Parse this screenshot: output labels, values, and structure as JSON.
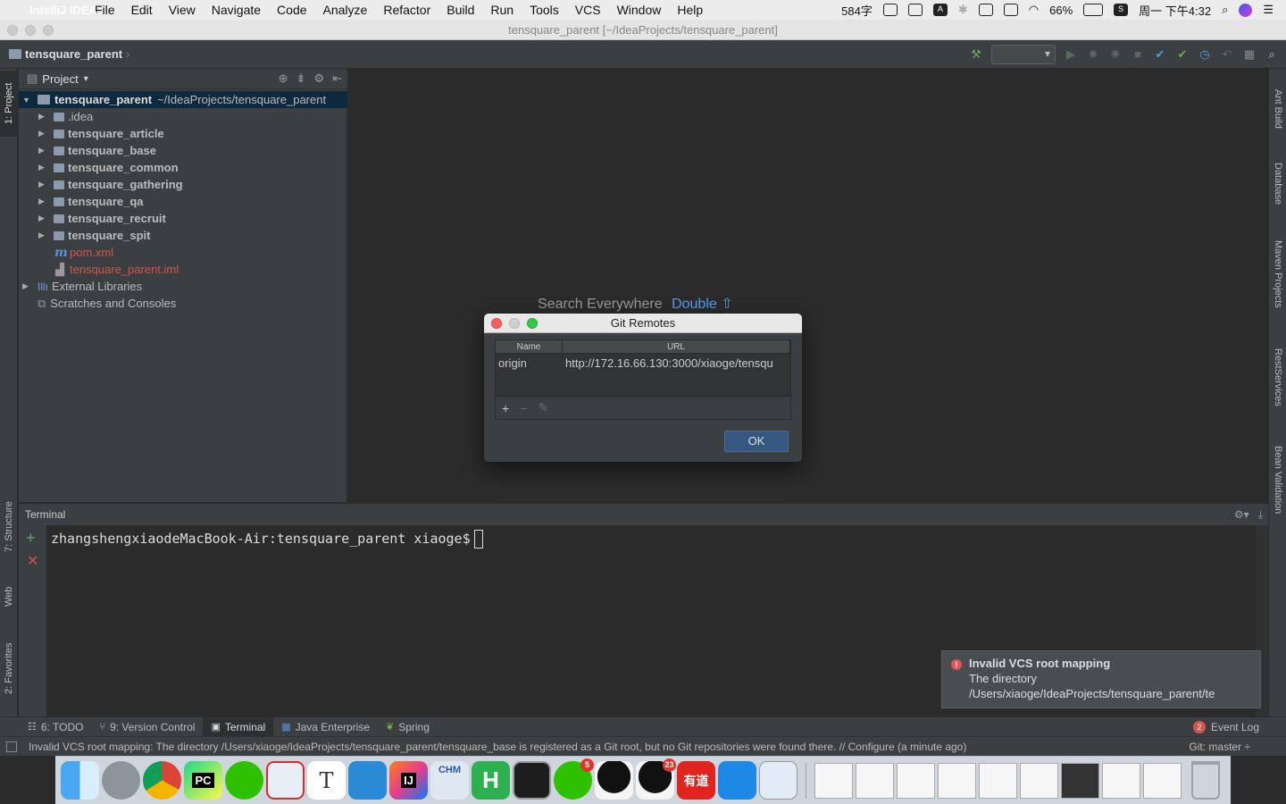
{
  "menubar": {
    "app_name": "IntelliJ IDEA",
    "items": [
      "File",
      "Edit",
      "View",
      "Navigate",
      "Code",
      "Analyze",
      "Refactor",
      "Build",
      "Run",
      "Tools",
      "VCS",
      "Window",
      "Help"
    ],
    "word_count": "584字",
    "battery": "66%",
    "clock": "周一 下午4:32"
  },
  "window": {
    "title": "tensquare_parent [~/IdeaProjects/tensquare_parent]"
  },
  "navbar": {
    "breadcrumb": "tensquare_parent"
  },
  "left_stripe": {
    "project": "1: Project",
    "structure": "7: Structure",
    "web": "Web",
    "favorites": "2: Favorites"
  },
  "right_stripe": {
    "ant": "Ant Build",
    "database": "Database",
    "maven": "Maven Projects",
    "rest": "RestServices",
    "bean": "Bean Validation"
  },
  "project_panel": {
    "title": "Project",
    "root": {
      "name": "tensquare_parent",
      "path": "~/IdeaProjects/tensquare_parent"
    },
    "items": [
      {
        "name": ".idea"
      },
      {
        "name": "tensquare_article"
      },
      {
        "name": "tensquare_base"
      },
      {
        "name": "tensquare_common"
      },
      {
        "name": "tensquare_gathering"
      },
      {
        "name": "tensquare_qa"
      },
      {
        "name": "tensquare_recruit"
      },
      {
        "name": "tensquare_spit"
      },
      {
        "name": "pom.xml"
      },
      {
        "name": "tensquare_parent.iml"
      }
    ],
    "external": "External Libraries",
    "scratches": "Scratches and Consoles"
  },
  "editor": {
    "hint_text": "Search Everywhere",
    "hint_key": "Double ⇧"
  },
  "dialog": {
    "title": "Git Remotes",
    "columns": [
      "Name",
      "URL"
    ],
    "rows": [
      {
        "name": "origin",
        "url": "http://172.16.66.130:3000/xiaoge/tensqu"
      }
    ],
    "ok": "OK"
  },
  "terminal": {
    "title": "Terminal",
    "prompt": "zhangshengxiaodeMacBook-Air:tensquare_parent xiaoge$"
  },
  "notification": {
    "title": "Invalid VCS root mapping",
    "line1": "The directory",
    "line2": "/Users/xiaoge/IdeaProjects/tensquare_parent/te"
  },
  "toolwindows": {
    "todo": "6: TODO",
    "vcs": "9: Version Control",
    "terminal": "Terminal",
    "javaee": "Java Enterprise",
    "spring": "Spring",
    "event_log": "Event Log",
    "event_count": "2"
  },
  "statusbar": {
    "message": "Invalid VCS root mapping: The directory /Users/xiaoge/IdeaProjects/tensquare_parent/tensquare_base is registered as a Git root, but no Git repositories were found there. // Configure (a minute ago)",
    "git": "Git: master ÷"
  },
  "dock": {
    "pycharm": "PC",
    "intellij": "IJ",
    "chm": "CHM",
    "hbuilder": "H",
    "wechat_badge": "5",
    "qq_badge": "23",
    "youdao": "有道"
  },
  "colors": {
    "accent": "#589df6",
    "error": "#d4534e",
    "selection": "#0d293e"
  }
}
